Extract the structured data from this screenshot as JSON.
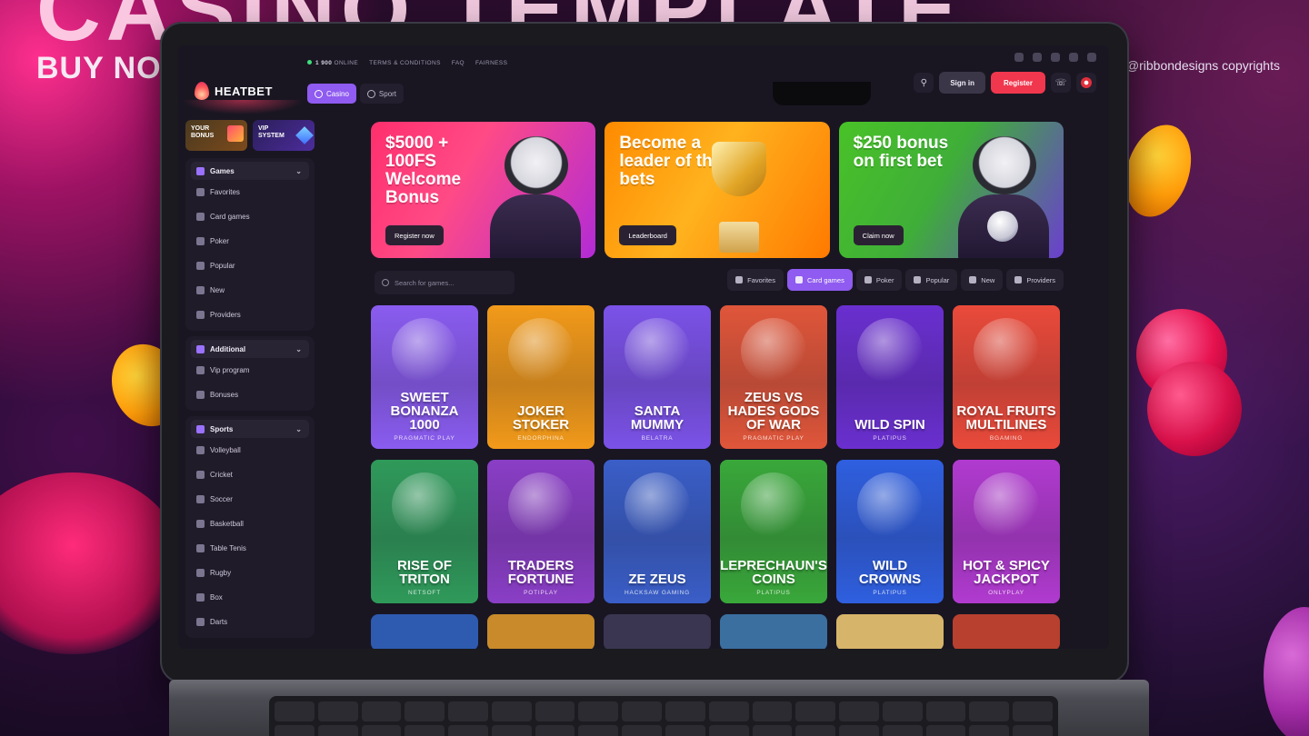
{
  "promo": {
    "headline": "CASINO TEMPLATE",
    "buy_now": "BUY NOW",
    "copyright": "@ribbondesigns copyrights"
  },
  "app": {
    "brand": "HEATBET",
    "online_count": "1 900",
    "online_label": "ONLINE",
    "top_links": [
      "TERMS & CONDITIONS",
      "FAQ",
      "FAIRNESS"
    ],
    "mode_tabs": [
      {
        "label": "Casino",
        "active": true
      },
      {
        "label": "Sport",
        "active": false
      }
    ],
    "actions": {
      "signin": "Sign in",
      "register": "Register"
    }
  },
  "sidebar": {
    "promos": [
      {
        "line1": "YOUR",
        "line2": "BONUS"
      },
      {
        "line1": "VIP",
        "line2": "SYSTEM"
      }
    ],
    "games_group": {
      "title": "Games",
      "items": [
        "Favorites",
        "Card games",
        "Poker",
        "Popular",
        "New",
        "Providers"
      ]
    },
    "additional_group": {
      "title": "Additional",
      "items": [
        "Vip program",
        "Bonuses"
      ]
    },
    "sports_group": {
      "title": "Sports",
      "items": [
        "Volleyball",
        "Cricket",
        "Soccer",
        "Basketball",
        "Table Tenis",
        "Rugby",
        "Box",
        "Darts"
      ]
    }
  },
  "banners": [
    {
      "title": "$5000 + 100FS Welcome Bonus",
      "button": "Register now"
    },
    {
      "title": "Become a leader of the bets",
      "button": "Leaderboard"
    },
    {
      "title": "$250 bonus on first bet",
      "button": "Claim now"
    }
  ],
  "filters": {
    "search_placeholder": "Search for games...",
    "chips": [
      {
        "label": "Favorites",
        "active": false
      },
      {
        "label": "Card games",
        "active": true
      },
      {
        "label": "Poker",
        "active": false
      },
      {
        "label": "Popular",
        "active": false
      },
      {
        "label": "New",
        "active": false
      },
      {
        "label": "Providers",
        "active": false
      }
    ]
  },
  "games": [
    {
      "name": "SWEET BONANZA 1000",
      "provider": "PRAGMATIC PLAY",
      "color": "#8a5cf0"
    },
    {
      "name": "JOKER STOKER",
      "provider": "ENDORPHINA",
      "color": "#f29a1a"
    },
    {
      "name": "SANTA MUMMY",
      "provider": "BELATRA",
      "color": "#7b52e8"
    },
    {
      "name": "ZEUS VS HADES GODS OF WAR",
      "provider": "PRAGMATIC PLAY",
      "color": "#e0563a"
    },
    {
      "name": "WILD SPIN",
      "provider": "PLATIPUS",
      "color": "#6a2fd0"
    },
    {
      "name": "ROYAL FRUITS MULTILINES",
      "provider": "BGAMING",
      "color": "#ea4a3a"
    },
    {
      "name": "RISE OF TRITON",
      "provider": "NETSOFT",
      "color": "#2f9a5a"
    },
    {
      "name": "TRADERS FORTUNE",
      "provider": "POTIPLAY",
      "color": "#8a3ec6"
    },
    {
      "name": "ZE ZEUS",
      "provider": "HACKSAW GAMING",
      "color": "#3a5ec8"
    },
    {
      "name": "LEPRECHAUN'S COINS",
      "provider": "PLATIPUS",
      "color": "#39a83a"
    },
    {
      "name": "WILD CROWNS",
      "provider": "PLATIPUS",
      "color": "#2f5fe0"
    },
    {
      "name": "HOT & SPICY JACKPOT",
      "provider": "ONLYPLAY",
      "color": "#b13ad0"
    }
  ],
  "row3_colors": [
    "#2e5bb0",
    "#c88a2a",
    "#3a3550",
    "#3a6fa0",
    "#d6b46a",
    "#b8402f"
  ]
}
